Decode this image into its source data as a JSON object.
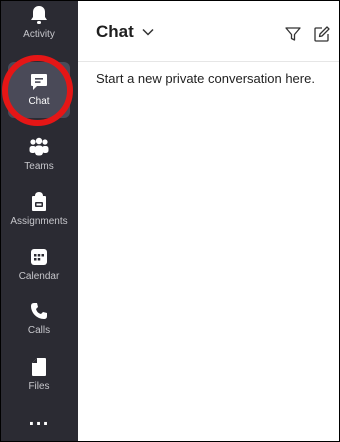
{
  "rail": {
    "items": [
      {
        "label": "Activity",
        "icon": "bell-icon"
      },
      {
        "label": "Chat",
        "icon": "chat-icon",
        "active": true
      },
      {
        "label": "Teams",
        "icon": "teams-icon"
      },
      {
        "label": "Assignments",
        "icon": "assignments-icon"
      },
      {
        "label": "Calendar",
        "icon": "calendar-icon"
      },
      {
        "label": "Calls",
        "icon": "phone-icon"
      },
      {
        "label": "Files",
        "icon": "file-icon"
      }
    ],
    "more_label": "..."
  },
  "header": {
    "title": "Chat"
  },
  "main": {
    "empty_message": "Start a new private conversation here."
  },
  "colors": {
    "rail_bg": "#2b2b33",
    "active_bg": "#4a4a58",
    "highlight_ring": "#e51616"
  }
}
